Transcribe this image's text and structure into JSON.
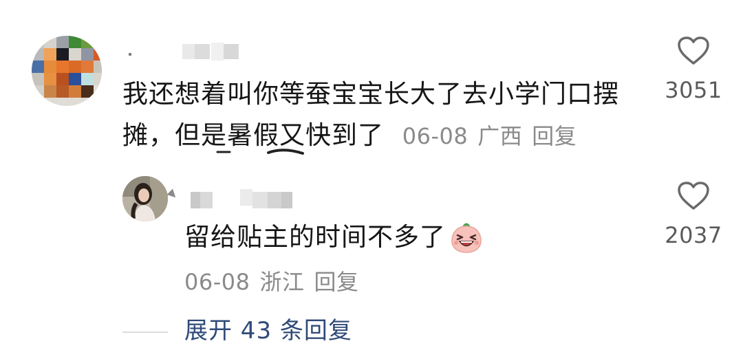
{
  "comment": {
    "username": "",
    "text_line1": "我还想着叫你等蚕宝宝长大了去小学门口摆",
    "text_line2": "摊，但是暑假又快到了",
    "date": "06-08",
    "location": "广西",
    "reply_label": "回复",
    "likes": "3051"
  },
  "reply": {
    "username": "",
    "text": "留给贴主的时间不多了",
    "emoji": "laughing-emoji",
    "date": "06-08",
    "location": "浙江",
    "reply_label": "回复",
    "likes": "2037"
  },
  "expand": {
    "label": "展开 43 条回复"
  },
  "icons": {
    "like": "heart-outline-icon"
  },
  "colors": {
    "text": "#161616",
    "meta": "#8a8a8a",
    "link": "#2f4a78",
    "heart_stroke": "#6a6a6a"
  }
}
